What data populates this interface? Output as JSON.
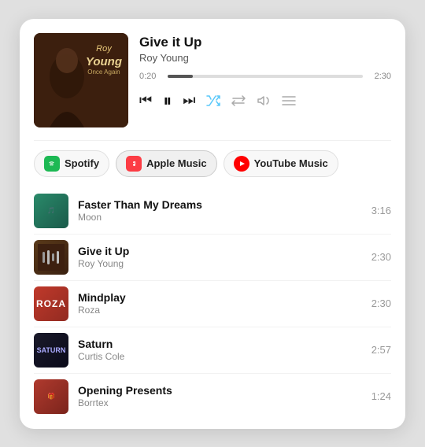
{
  "nowPlaying": {
    "title": "Give it Up",
    "artist": "Roy Young",
    "albumArt": {
      "line1": "Roy",
      "line2": "Young",
      "line3": "Once Again"
    },
    "progress": {
      "current": "0:20",
      "total": "2:30",
      "percent": 13
    }
  },
  "controls": {
    "rewind": "⏮",
    "pause": "⏸",
    "forward": "⏭",
    "shuffle": "shuffle",
    "repeat": "repeat",
    "volume": "volume",
    "queue": "queue"
  },
  "services": [
    {
      "id": "spotify",
      "label": "Spotify",
      "iconType": "spotify",
      "active": false
    },
    {
      "id": "apple",
      "label": "Apple Music",
      "iconType": "apple",
      "active": true
    },
    {
      "id": "youtube",
      "label": "YouTube Music",
      "iconType": "youtube",
      "active": false
    }
  ],
  "tracks": [
    {
      "id": 1,
      "title": "Faster Than My Dreams",
      "artist": "Moon",
      "duration": "3:16",
      "thumbClass": "thumb-1"
    },
    {
      "id": 2,
      "title": "Give it Up",
      "artist": "Roy Young",
      "duration": "2:30",
      "thumbClass": "thumb-2"
    },
    {
      "id": 3,
      "title": "Mindplay",
      "artist": "Roza",
      "duration": "2:30",
      "thumbClass": "thumb-3"
    },
    {
      "id": 4,
      "title": "Saturn",
      "artist": "Curtis Cole",
      "duration": "2:57",
      "thumbClass": "thumb-4"
    },
    {
      "id": 5,
      "title": "Opening Presents",
      "artist": "Borrtex",
      "duration": "1:24",
      "thumbClass": "thumb-5"
    }
  ]
}
